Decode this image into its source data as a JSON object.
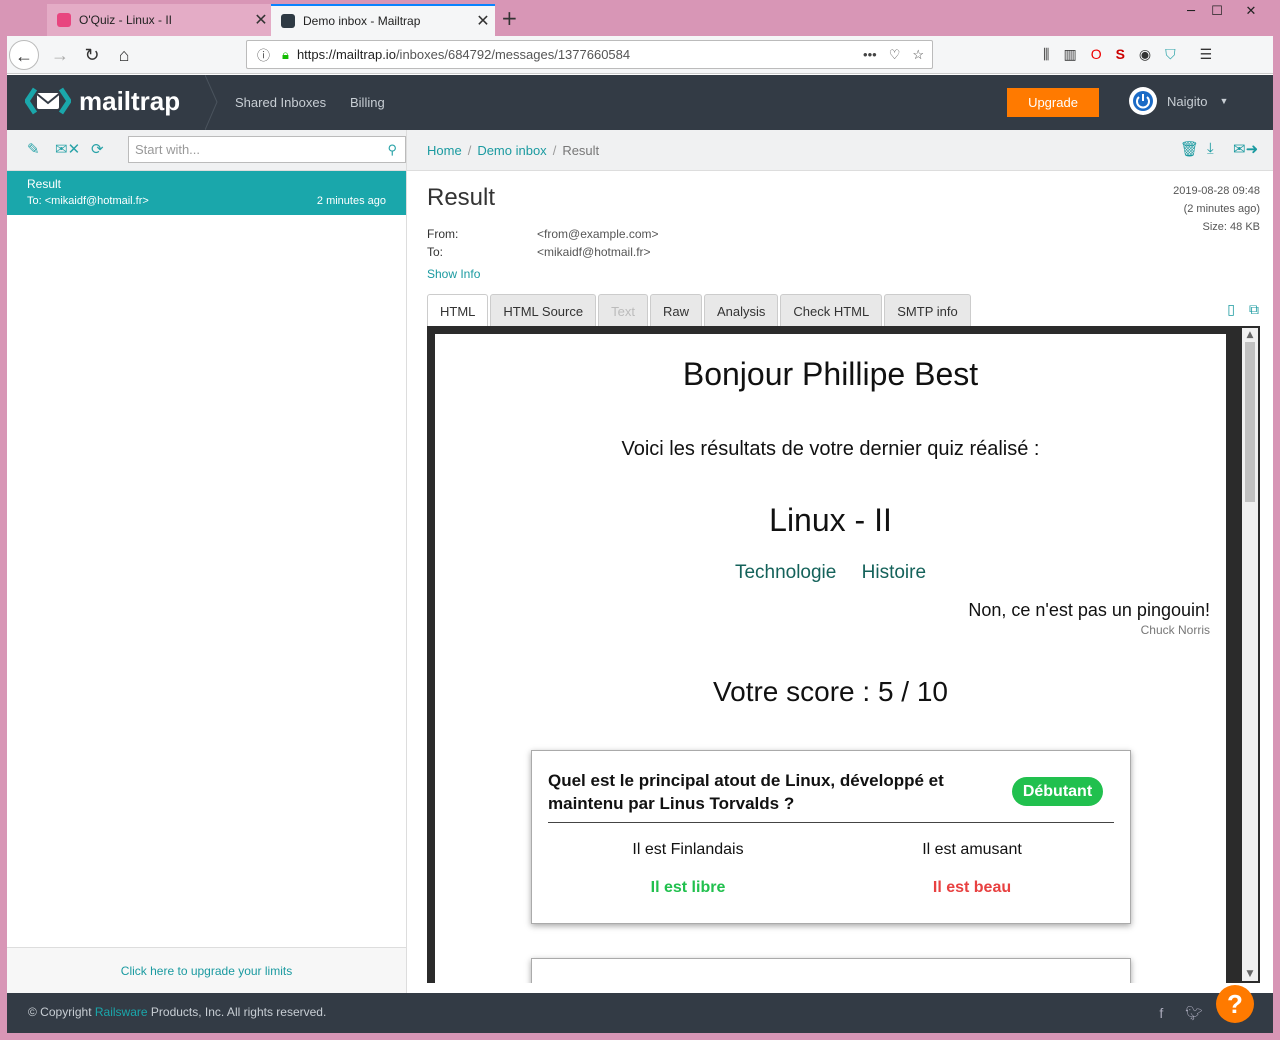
{
  "browser": {
    "tabs": [
      {
        "title": "O'Quiz - Linux - II"
      },
      {
        "title": "Demo inbox - Mailtrap"
      }
    ],
    "url": {
      "host": "https://mailtrap.io",
      "path": "/inboxes/684792/messages/1377660584"
    }
  },
  "app": {
    "logo_text": "mailtrap",
    "nav": [
      "Shared Inboxes",
      "Billing"
    ],
    "upgrade_label": "Upgrade",
    "user_name": "Naigito"
  },
  "sidebar": {
    "search_placeholder": "Start with...",
    "messages": [
      {
        "subject": "Result",
        "to": "To: <mikaidf@hotmail.fr>",
        "time": "2 minutes ago"
      }
    ],
    "upgrade_link": "Click here to upgrade your limits"
  },
  "breadcrumb": [
    "Home",
    "Demo inbox",
    "Result"
  ],
  "message": {
    "title": "Result",
    "date": "2019-08-28 09:48",
    "ago": "(2 minutes ago)",
    "size": "Size: 48 KB",
    "from_label": "From:",
    "from": "<from@example.com>",
    "to_label": "To:",
    "to": "<mikaidf@hotmail.fr>",
    "show_info": "Show Info",
    "tabs": [
      "HTML",
      "HTML Source",
      "Text",
      "Raw",
      "Analysis",
      "Check HTML",
      "SMTP info"
    ]
  },
  "email": {
    "greeting": "Bonjour Phillipe Best",
    "intro": "Voici les résultats de votre dernier quiz réalisé :",
    "quiz_title": "Linux - II",
    "tags": [
      "Technologie",
      "Histoire"
    ],
    "quote": "Non, ce n'est pas un pingouin!",
    "quote_author": "Chuck Norris",
    "score": "Votre score : 5 / 10",
    "question": {
      "text": "Quel est le principal atout de Linux, développé et maintenu par Linus Torvalds ?",
      "level": "Débutant",
      "answers": [
        "Il est Finlandais",
        "Il est amusant",
        "Il est libre",
        "Il est beau"
      ]
    }
  },
  "footer": {
    "copyright_pre": "© Copyright ",
    "copyright_link": "Railsware",
    "copyright_post": " Products, Inc. All rights reserved."
  },
  "colors": {
    "accent": "#1aa7ab",
    "header": "#333b45",
    "upgrade": "#ff7a00",
    "correct": "#21c04e",
    "wrong": "#e84141"
  }
}
